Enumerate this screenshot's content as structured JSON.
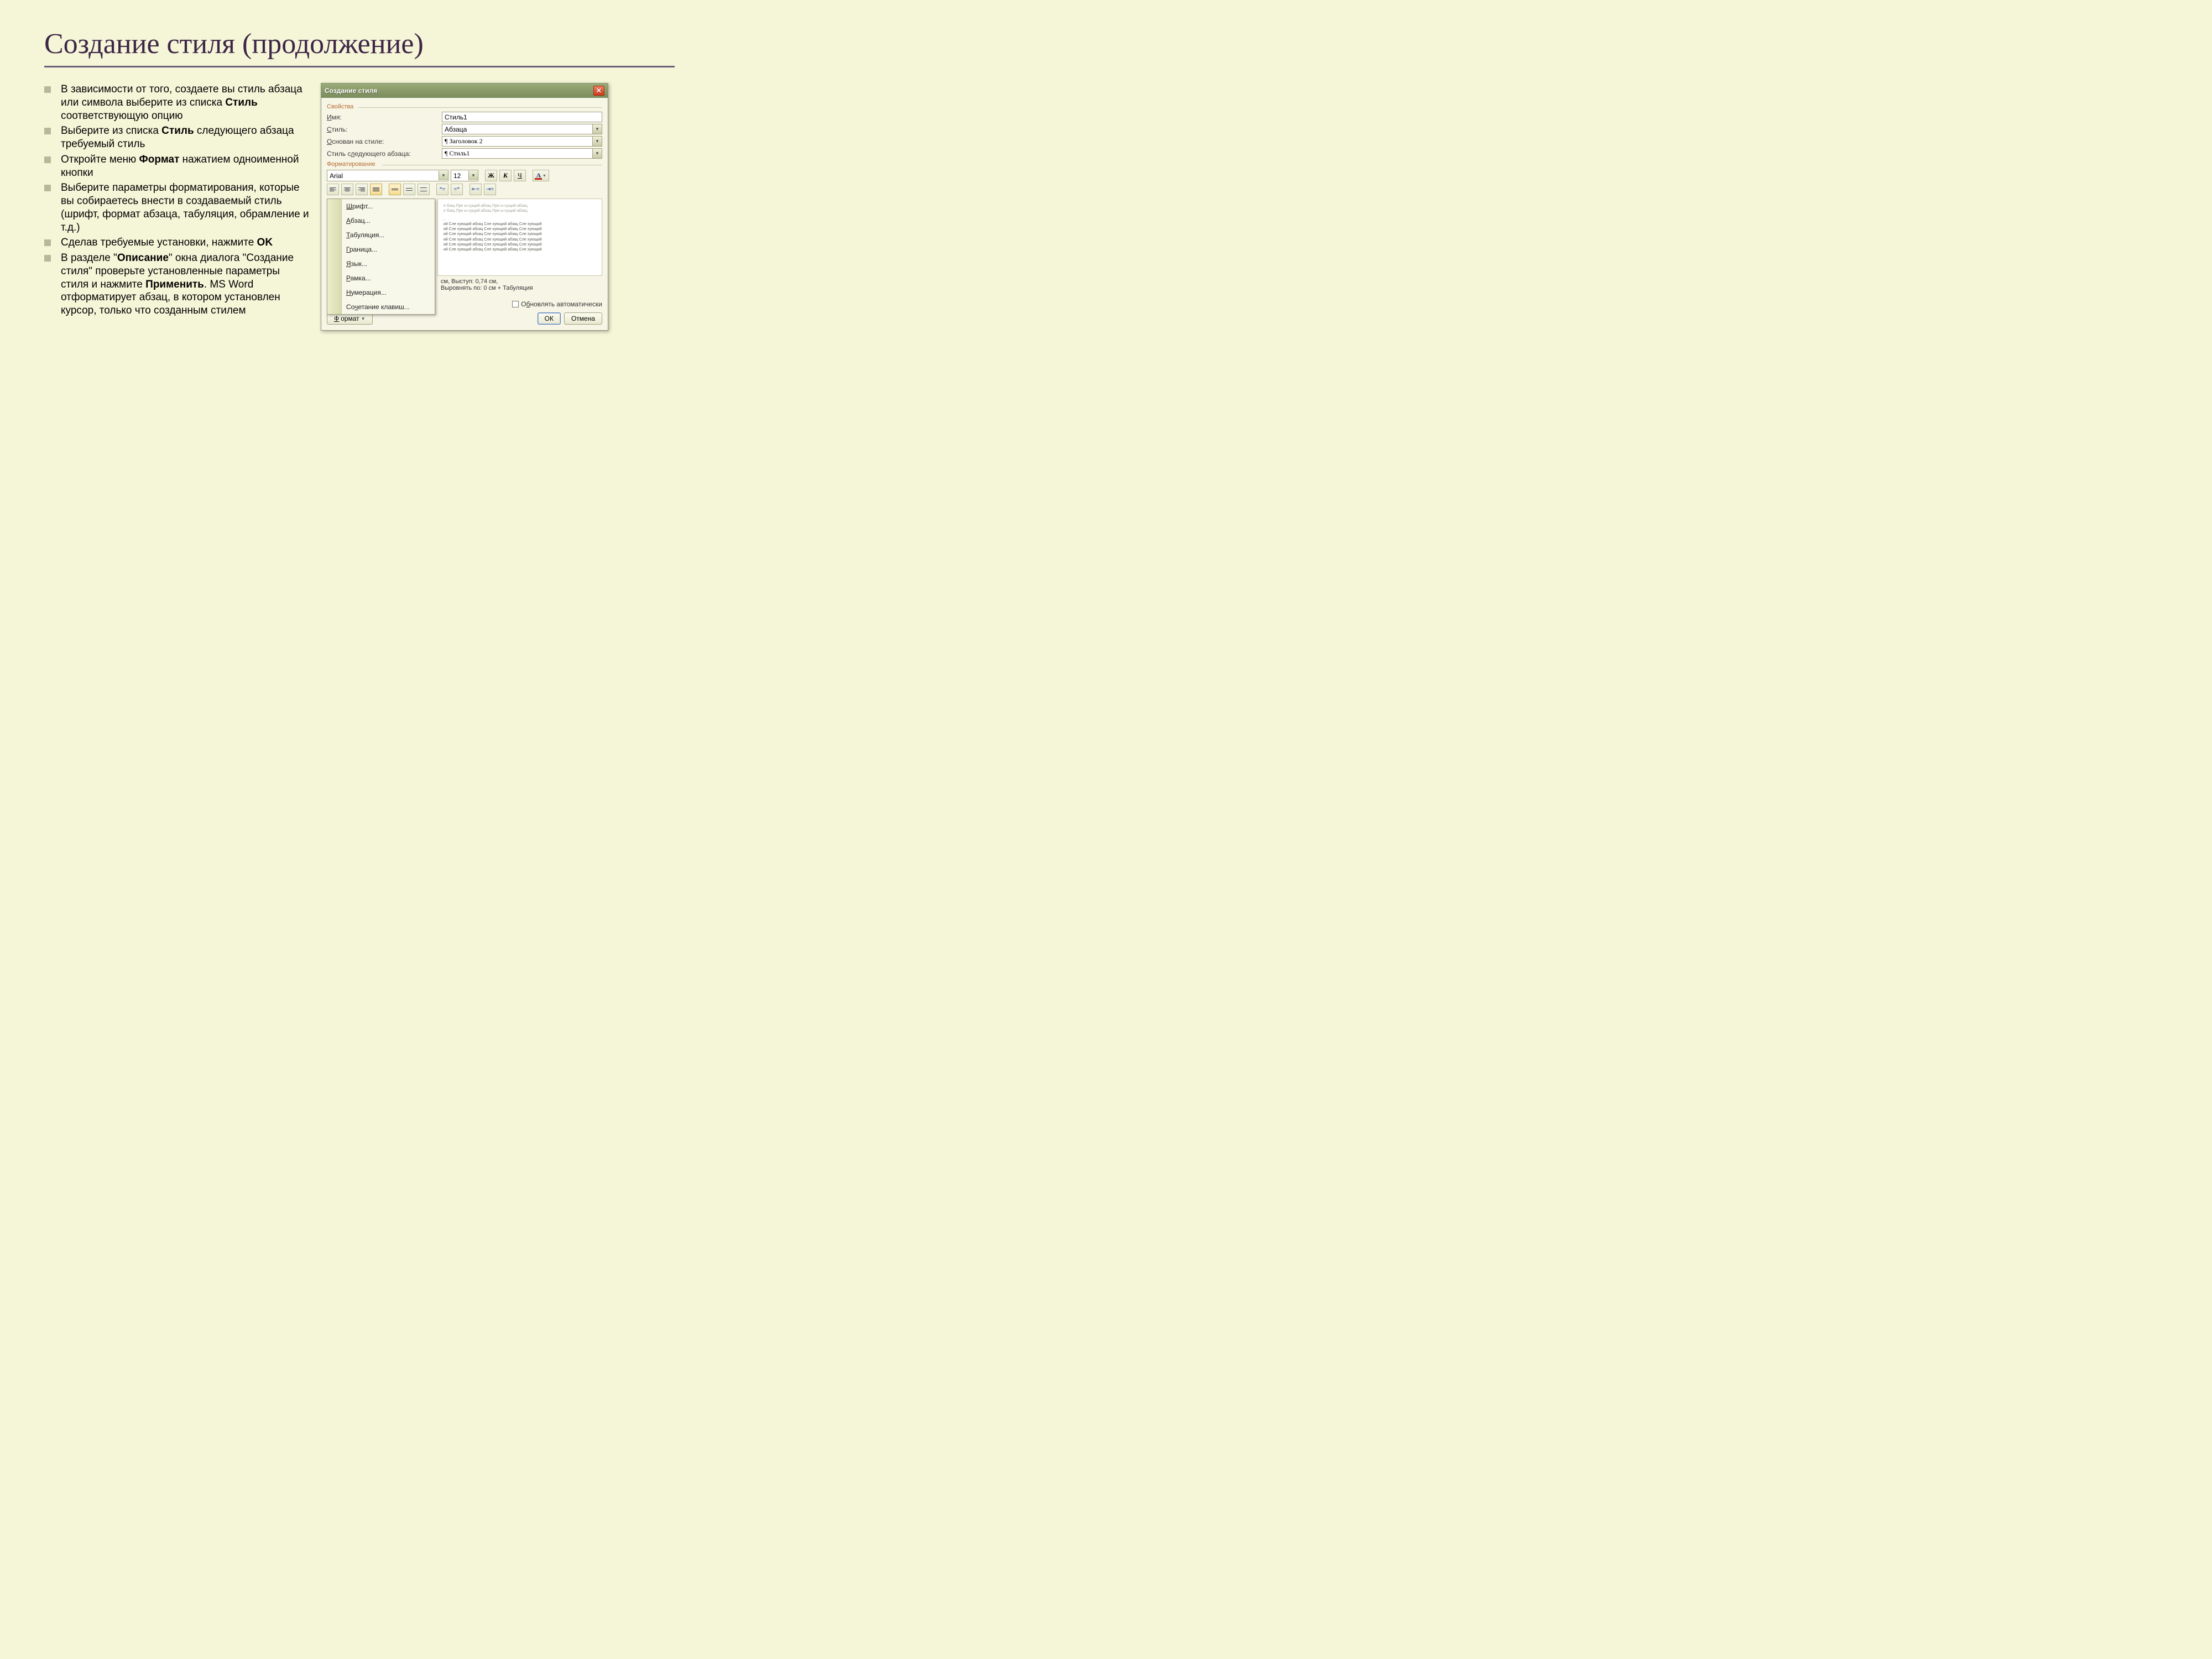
{
  "slide": {
    "title": "Создание стиля (продолжение)",
    "bullets": [
      {
        "pre": "В зависимости от того, создаете вы стиль абзаца или символа выберите из списка ",
        "b": "Стиль",
        "post": " соответствующую опцию"
      },
      {
        "pre": "Выберите из списка ",
        "b": "Стиль",
        "post": " следующего абзаца требуемый стиль"
      },
      {
        "pre": "Откройте меню ",
        "b": "Формат",
        "post": " нажатием одноименной кнопки"
      },
      {
        "pre": "Выберите параметры форматирования, которые вы собираетесь внести в создаваемый стиль (шрифт, формат абзаца, табуляция, обрамление и т.д.)",
        "b": "",
        "post": ""
      },
      {
        "pre": "Сделав требуемые установки, нажмите ",
        "b": "OK",
        "post": ""
      },
      {
        "pre": "В разделе \"",
        "b": "Описание",
        "mid": "\" окна диалога \"Создание стиля\" проверьте установленные параметры стиля и нажмите ",
        "b2": "Применить",
        "post": ". MS Word отформатирует абзац, в котором установлен курсор, только что созданным стилем"
      }
    ]
  },
  "dialog": {
    "title": "Создание стиля",
    "close_x": "✕",
    "group_properties": "Свойства",
    "group_formatting": "Форматирование",
    "labels": {
      "name": "Имя:",
      "style": "Стиль:",
      "based_on": "Основан на стиле:",
      "next_style": "Стиль следующего абзаца:"
    },
    "underline": {
      "name": "И",
      "style": "С",
      "based": "О",
      "next": "л"
    },
    "values": {
      "name": "Стиль1",
      "style": "Абзаца",
      "based_on": "¶ Заголовок 2",
      "next_style": "¶ Стиль1",
      "font": "Arial",
      "size": "12"
    },
    "bold": "Ж",
    "italic": "К",
    "underlinebtn": "Ч",
    "color_letter": "А",
    "desc_line1": "см, Выступ:  0,74 см,",
    "desc_line2": "Выровнять по:  0 см + Табуляция",
    "auto_update": "Обновлять автоматически",
    "auto_update_u": "б",
    "format_btn": "Формат",
    "format_u": "Ф",
    "ok_btn": "ОК",
    "cancel_btn": "Отмена",
    "menu": [
      {
        "u": "Ш",
        "label": "рифт..."
      },
      {
        "u": "А",
        "label": "бзац..."
      },
      {
        "u": "Т",
        "label": "абуляция..."
      },
      {
        "u": "Г",
        "label": "раница..."
      },
      {
        "u": "Я",
        "label": "зык..."
      },
      {
        "u": "Р",
        "label": "амка..."
      },
      {
        "u": "Н",
        "label": "умерация..."
      },
      {
        "pre": "Со",
        "u": "ч",
        "label": "етание клавиш..."
      }
    ],
    "preview_gray": "е бзац Пре ы-сущий абзац Пре ы-сущий абзац",
    "preview_follow": "ий Сле хующий абзац Сле хующий абзац Сле хующий"
  }
}
